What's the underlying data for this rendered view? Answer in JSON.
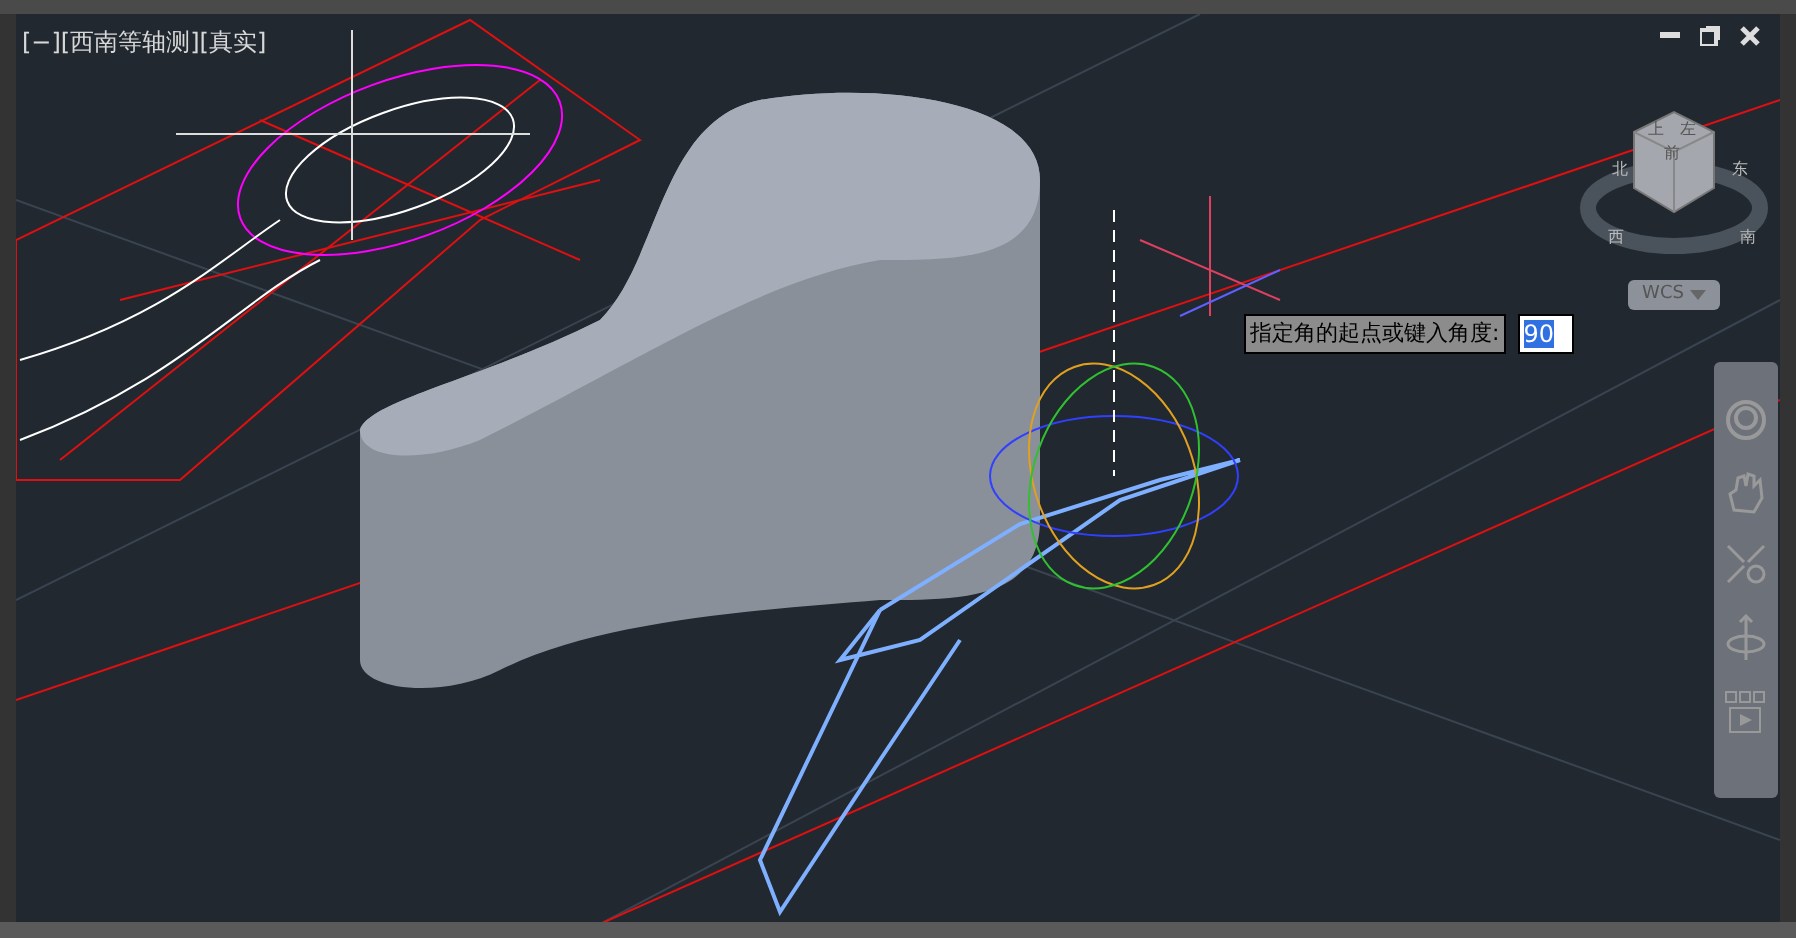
{
  "viewport": {
    "label": "[−][西南等轴测][真实]"
  },
  "view_cube": {
    "faces": [
      "上",
      "左",
      "前"
    ],
    "compass": [
      "北",
      "东",
      "西",
      "南"
    ]
  },
  "ucs_menu": {
    "label": "WCS"
  },
  "prompt": {
    "text": "指定角的起点或键入角度:",
    "value": "90"
  }
}
